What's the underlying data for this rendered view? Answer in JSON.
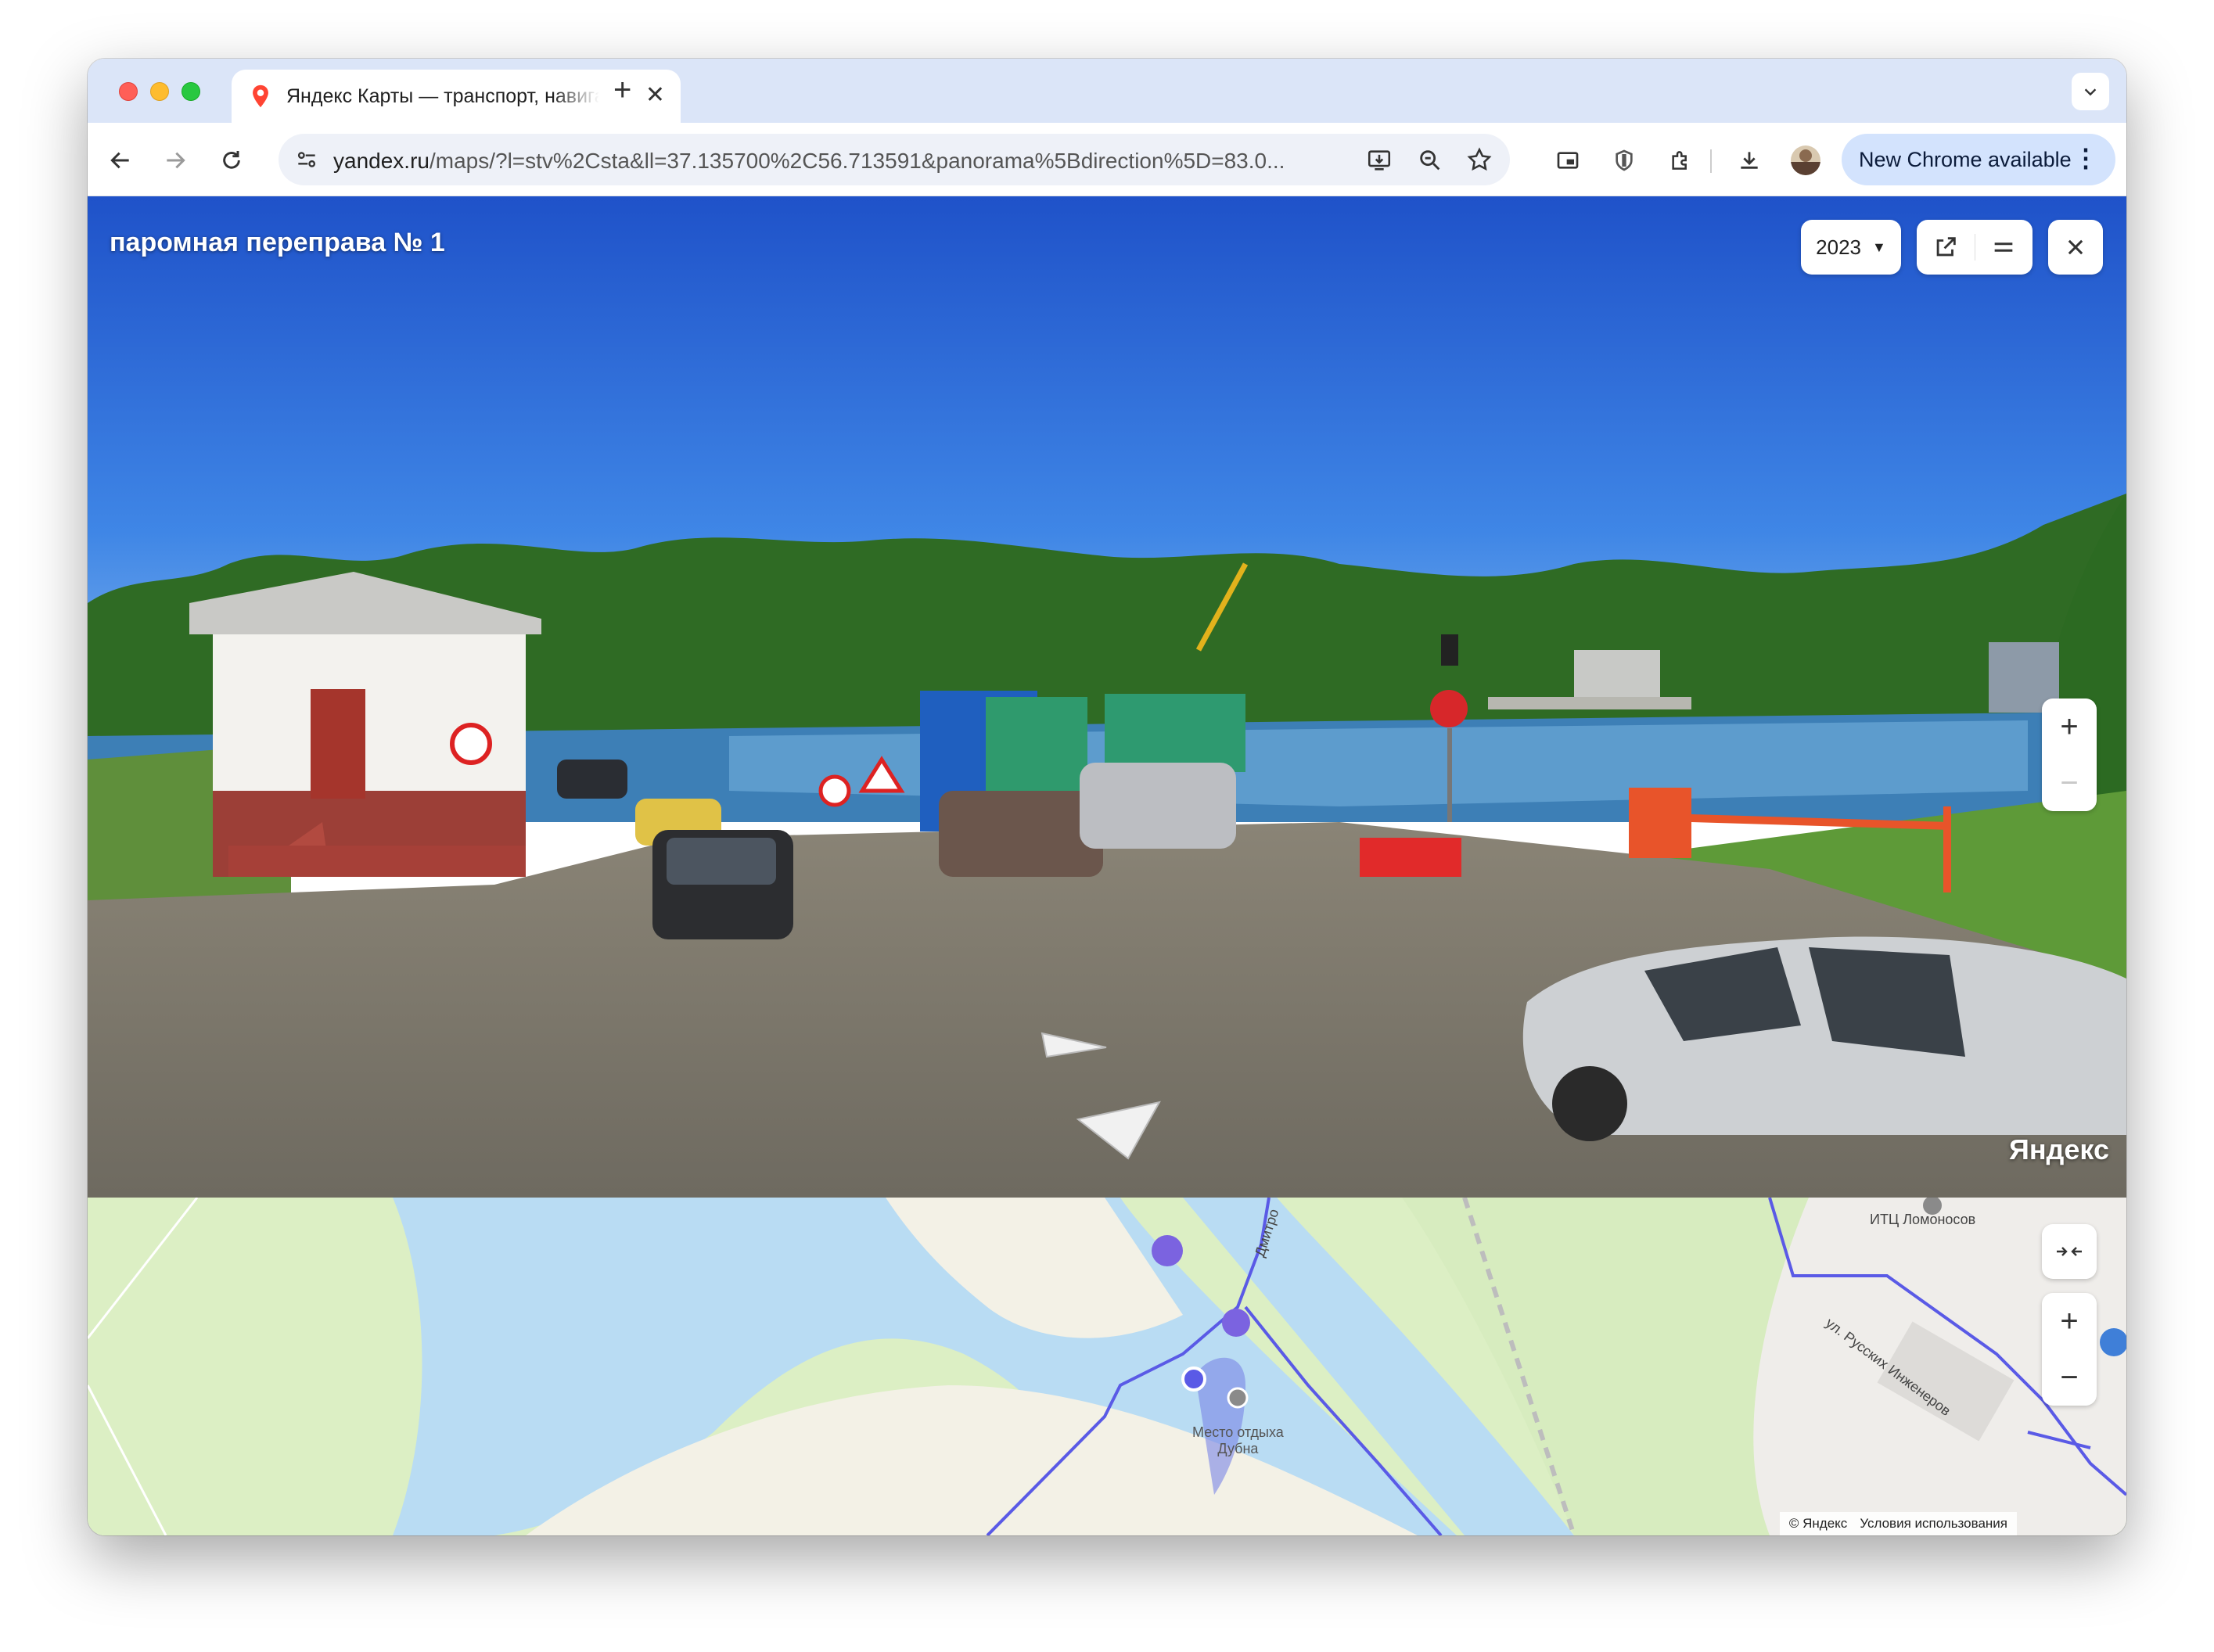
{
  "browser": {
    "tab_title": "Яндекс Карты — транспорт, навигация, поиск мест",
    "new_tab_symbol": "+",
    "url_host": "yandex.ru",
    "url_path": "/maps/?l=stv%2Csta&ll=37.135700%2C56.713591&panorama%5Bdirection%5D=83.0...",
    "update_label": "New Chrome available",
    "icons": [
      "back-icon",
      "forward-icon",
      "reload-icon",
      "site-settings-icon",
      "install-app-icon",
      "zoom-icon",
      "bookmark-star-icon",
      "picture-in-picture-icon",
      "shield-extension-icon",
      "extensions-puzzle-icon",
      "downloads-icon",
      "profile-avatar",
      "kebab-menu-icon"
    ]
  },
  "panorama": {
    "title": "паромная переправа № 1",
    "year": "2023",
    "watermark": "Яндекс"
  },
  "map": {
    "labels": {
      "poi_place": "Место отдыха\nДубна",
      "itc": "ИТЦ Ломоносов",
      "street_engineers": "ул. Русских Инженеров",
      "street_dmitrovskoe": "Дмитро"
    },
    "copyright": "© Яндекс",
    "terms": "Условия использования"
  },
  "colors": {
    "tabstrip": "#dbe5f8",
    "map_water": "#b9dcf3",
    "map_park": "#dcefc4",
    "route_blue": "#5a5ae6"
  }
}
